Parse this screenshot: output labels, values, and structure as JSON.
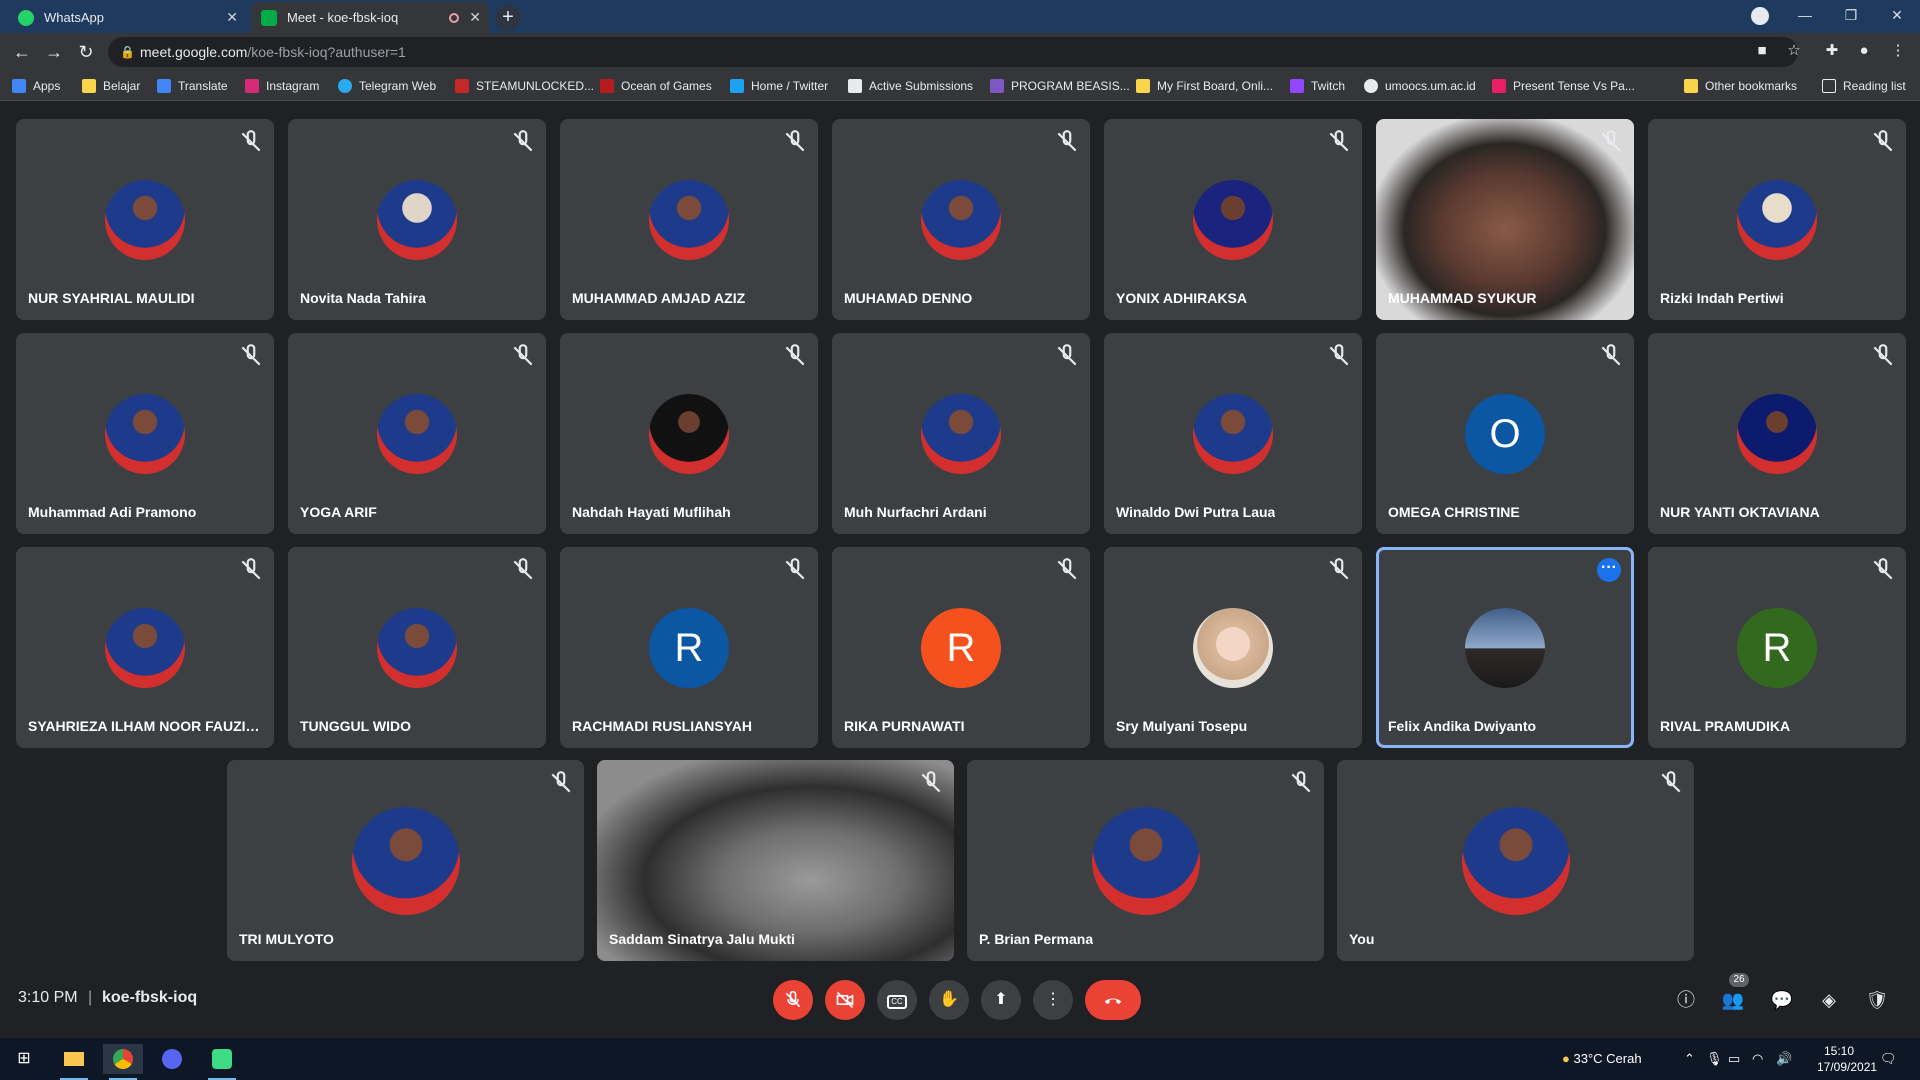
{
  "browser": {
    "tabs": [
      {
        "label": "WhatsApp"
      },
      {
        "label": "Meet - koe-fbsk-ioq"
      }
    ],
    "url_host": "meet.google.com",
    "url_path": "/koe-fbsk-ioq?authuser=1",
    "bookmarks": [
      "Apps",
      "Belajar",
      "Translate",
      "Instagram",
      "Telegram Web",
      "STEAMUNLOCKED...",
      "Ocean of Games",
      "Home / Twitter",
      "Active Submissions",
      "PROGRAM BEASIS...",
      "My First Board, Onli...",
      "Twitch",
      "umoocs.um.ac.id",
      "Present Tense Vs Pa...",
      "Other bookmarks",
      "Reading list"
    ]
  },
  "participants": [
    {
      "name": "NUR SYAHRIAL MAULIDI"
    },
    {
      "name": "Novita Nada Tahira"
    },
    {
      "name": "MUHAMMAD AMJAD AZIZ"
    },
    {
      "name": "MUHAMAD DENNO"
    },
    {
      "name": "YONIX ADHIRAKSA"
    },
    {
      "name": "MUHAMMAD SYUKUR"
    },
    {
      "name": "Rizki Indah Pertiwi"
    },
    {
      "name": "Muhammad Adi Pramono"
    },
    {
      "name": "YOGA ARIF"
    },
    {
      "name": "Nahdah Hayati Muflihah"
    },
    {
      "name": "Muh Nurfachri Ardani"
    },
    {
      "name": "Winaldo Dwi Putra Laua"
    },
    {
      "name": "OMEGA CHRISTINE",
      "initial": "O",
      "color": "#0b57a4"
    },
    {
      "name": "NUR YANTI OKTAVIANA"
    },
    {
      "name": "SYAHRIEZA ILHAM NOOR FAUZI 1..."
    },
    {
      "name": "TUNGGUL WIDO"
    },
    {
      "name": "RACHMADI RUSLIANSYAH",
      "initial": "R",
      "color": "#0b57a4"
    },
    {
      "name": "RIKA PURNAWATI",
      "initial": "R",
      "color": "#f4511e"
    },
    {
      "name": "Sry Mulyani Tosepu"
    },
    {
      "name": "Felix Andika Dwiyanto"
    },
    {
      "name": "RIVAL PRAMUDIKA",
      "initial": "R",
      "color": "#33691e"
    },
    {
      "name": "TRI MULYOTO"
    },
    {
      "name": "Saddam Sinatrya Jalu Mukti"
    },
    {
      "name": "P. Brian Permana"
    },
    {
      "name": "You"
    }
  ],
  "meeting": {
    "time": "3:10 PM",
    "separator": "|",
    "code": "koe-fbsk-ioq",
    "participant_count": "26"
  },
  "taskbar": {
    "weather": "33°C  Cerah",
    "time": "15:10",
    "date": "17/09/2021"
  },
  "colors": {
    "meet_bg": "#202124",
    "tile_bg": "#3c4043",
    "danger": "#ea4335",
    "accent": "#8ab4f8"
  }
}
